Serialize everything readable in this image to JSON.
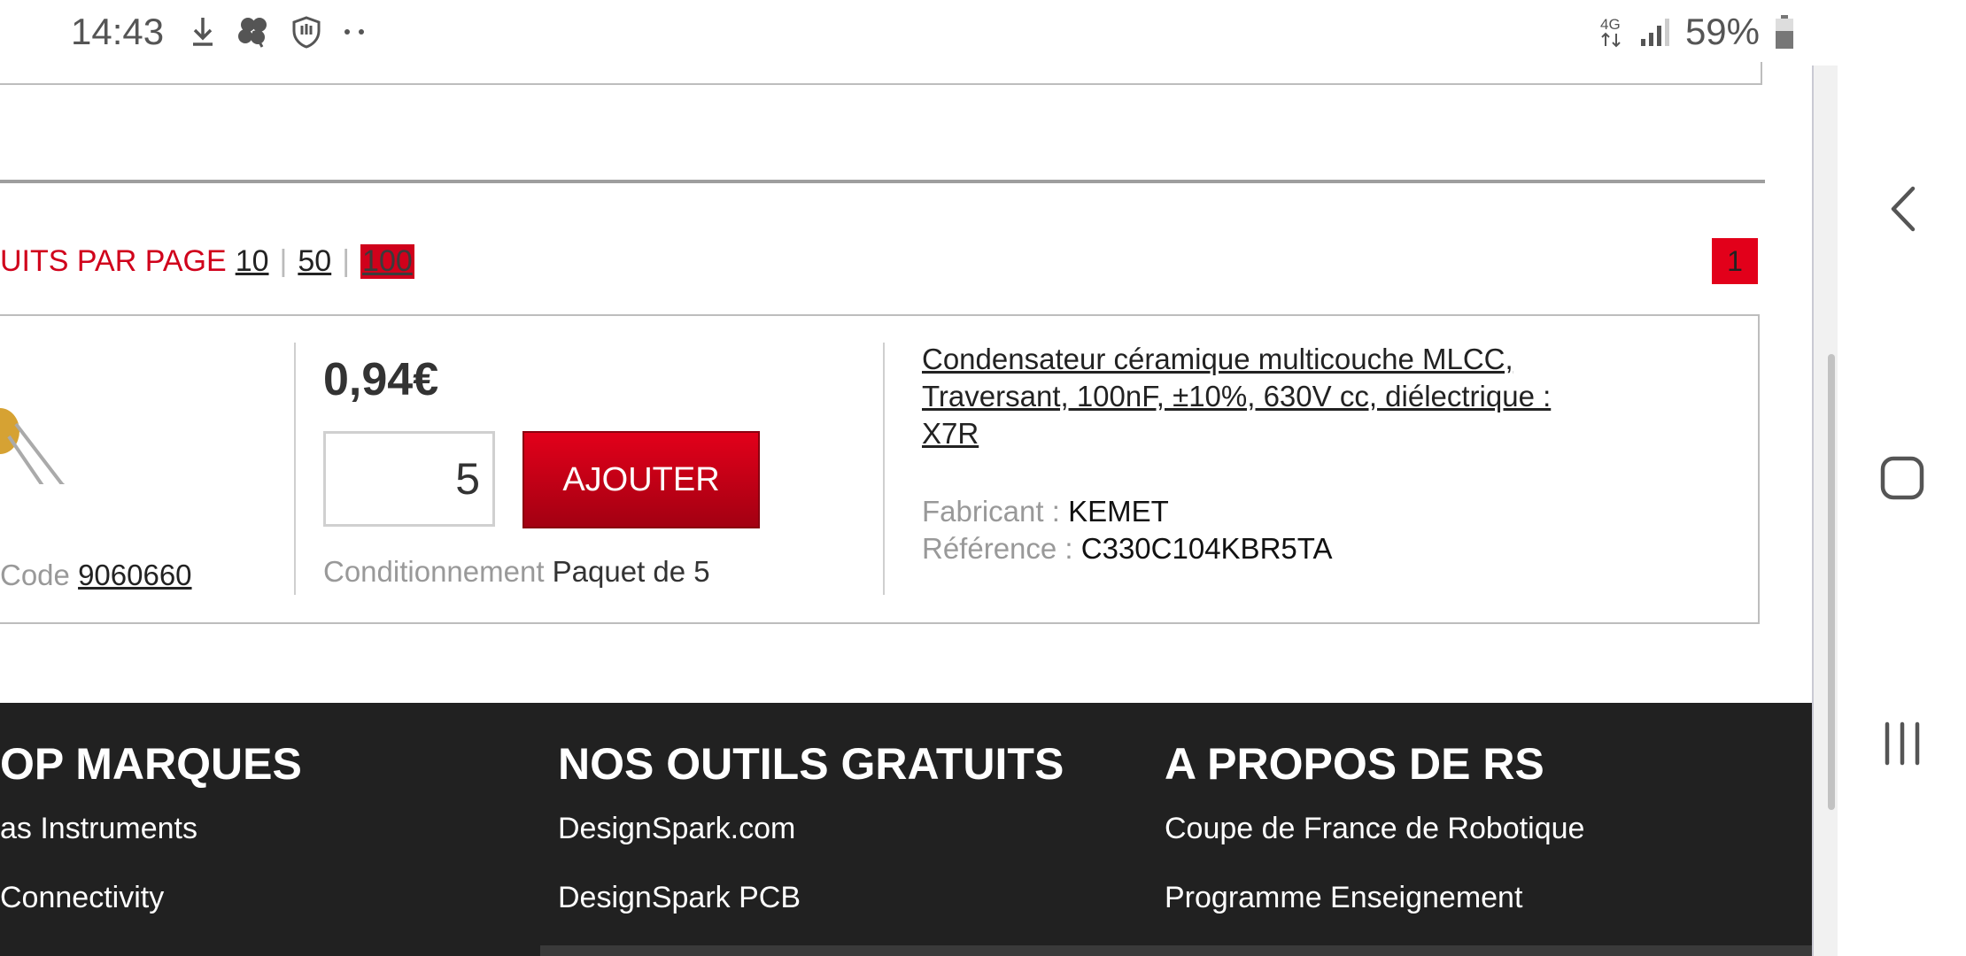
{
  "status_bar": {
    "time": "14:43",
    "left_icons": [
      "download-icon",
      "clover-icon",
      "shield-hand-icon",
      "more-dots-icon"
    ],
    "network": "4G",
    "battery": "59%"
  },
  "pagination": {
    "label": "UITS PAR PAGE",
    "options": [
      "10",
      "50",
      "100"
    ],
    "active": "100",
    "current_page": "1"
  },
  "product": {
    "code_label": "Code",
    "code_value": "9060660",
    "price": "0,94€",
    "quantity": "5",
    "add_label": "AJOUTER",
    "pack_label": "Conditionnement",
    "pack_value": "Paquet de 5",
    "description_line1": "Condensateur céramique multicouche MLCC,",
    "description_line2": "Traversant, 100nF, ±10%, 630V cc, diélectrique :",
    "description_line3": "X7R",
    "manufacturer_label": "Fabricant :",
    "manufacturer_value": "KEMET",
    "reference_label": "Référence :",
    "reference_value": "C330C104KBR5TA"
  },
  "footer": {
    "col1": {
      "title": "OP MARQUES",
      "links": [
        "as Instruments",
        "Connectivity"
      ]
    },
    "col2": {
      "title": "NOS OUTILS GRATUITS",
      "links": [
        "DesignSpark.com",
        "DesignSpark PCB"
      ]
    },
    "col3": {
      "title": "A PROPOS DE RS",
      "links": [
        "Coupe de France de Robotique",
        "Programme Enseignement"
      ]
    }
  },
  "nav": {
    "icons": [
      "back-icon",
      "home-icon",
      "recent-apps-icon"
    ]
  },
  "colors": {
    "brand_red": "#e2001a",
    "footer_bg": "#212121"
  }
}
